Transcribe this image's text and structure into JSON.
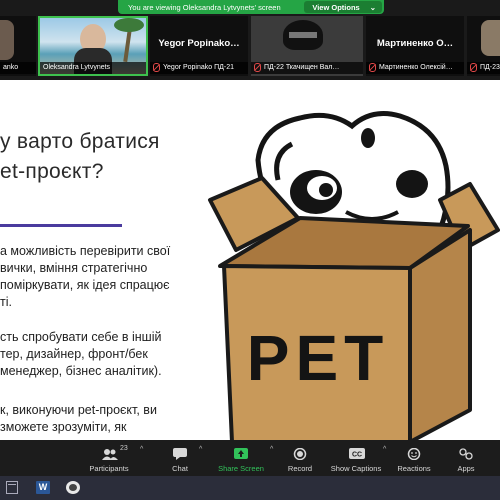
{
  "share_banner": {
    "text": "You are viewing Oleksandra Lytvynets' screen",
    "options_label": "View Options"
  },
  "gallery": [
    {
      "name": "anko",
      "big": ""
    },
    {
      "name": "Oleksandra Lytvynets",
      "big": ""
    },
    {
      "name": "Yegor Popinako ПД-21",
      "big": "Yegor Popinako…"
    },
    {
      "name": "ПД-22 Ткачищен Вал…",
      "big": ""
    },
    {
      "name": "Мартиненко Олексій…",
      "big": "Мартиненко О…"
    },
    {
      "name": "ПД-23",
      "big": ""
    }
  ],
  "slide": {
    "question_line1": "у варто братися",
    "question_line2": "et-проєкт?",
    "paragraph1": [
      "а можливість перевірити свої",
      "вички, вміння стратегічно",
      " поміркувати, як ідея спрацює",
      "ті."
    ],
    "paragraph2": [
      "сть спробувати себе в іншій",
      "тер, дизайнер, фронт/бек",
      " менеджер, бізнес аналітик)."
    ],
    "paragraph3": [
      "к, виконуючи pet-проєкт, ви",
      "зможете зрозуміти, як"
    ],
    "box_label": "PET"
  },
  "toolbar": {
    "participants_label": "Participants",
    "participants_count": "23",
    "chat_label": "Chat",
    "share_label": "Share Screen",
    "record_label": "Record",
    "captions_label": "Show Captions",
    "reactions_label": "Reactions",
    "apps_label": "Apps"
  },
  "colors": {
    "banner": "#25a545",
    "accent_line": "#4a3b9e",
    "box": "#c8995a"
  }
}
